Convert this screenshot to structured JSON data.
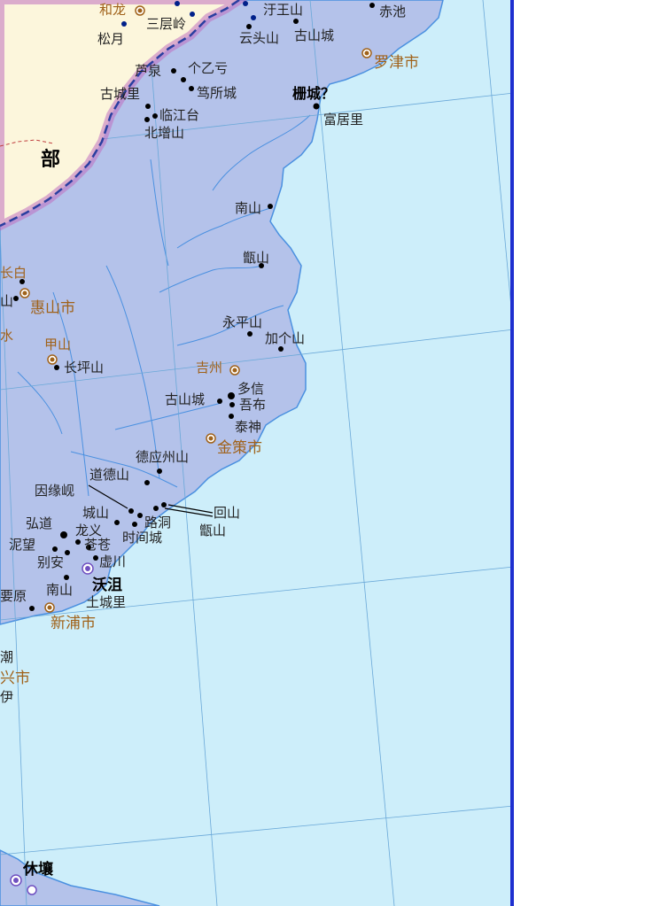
{
  "region_label": "部",
  "cities": {
    "najin": "罗津市",
    "hyesan": "惠山市",
    "kimchaek": "金策市",
    "sinpo": "新浦市",
    "kilju": "吉州",
    "kapsan": "甲山",
    "okjo": "沃沮",
    "xx_partial": "兴市",
    "hyuyang": "休壤"
  },
  "places": {
    "hwaryong": "和龙",
    "samcheungryeong": "三层岭",
    "songgang": "松月",
    "wangsan": "汙王山",
    "chiji": "赤池",
    "yundusan": "云头山",
    "gosansong_n": "古山城",
    "luchuan": "芦泉",
    "geyigan": "个乙亏",
    "gosongli": "古城里",
    "dusocheng": "笃所城",
    "imgangdae": "临江台",
    "bukjeungsan": "北增山",
    "sakseong": "栅城？",
    "bugeori": "富居里",
    "namsan_n": "南山",
    "jeungsan_n": "甑山",
    "yeongpyeongsan": "永平山",
    "gagaesan": "加个山",
    "changpyeongsan": "长坪山",
    "gosansong_s": "古山城",
    "duosin": "多信",
    "obu": "吾布",
    "taesin": "泰神",
    "deokeungjusan": "德应州山",
    "dodeoksan": "道德山",
    "inyeonhyeon": "因缘岘",
    "hongdo": "弘道",
    "seongsan": "城山",
    "longyi": "龙义",
    "rodong": "路洞",
    "hoesan": "回山",
    "jeungsan_s": "甑山",
    "nimang": "泥望",
    "changchang": "苍苍",
    "sigancheng": "时间城",
    "byeolan": "别安",
    "heochuan": "虚川",
    "namsan_s": "南山",
    "yowon": "要原",
    "toseongni": "土城里",
    "chao": "潮",
    "yi": "伊",
    "baek": "长白",
    "san_partial": "山",
    "bing_partial": "水"
  }
}
